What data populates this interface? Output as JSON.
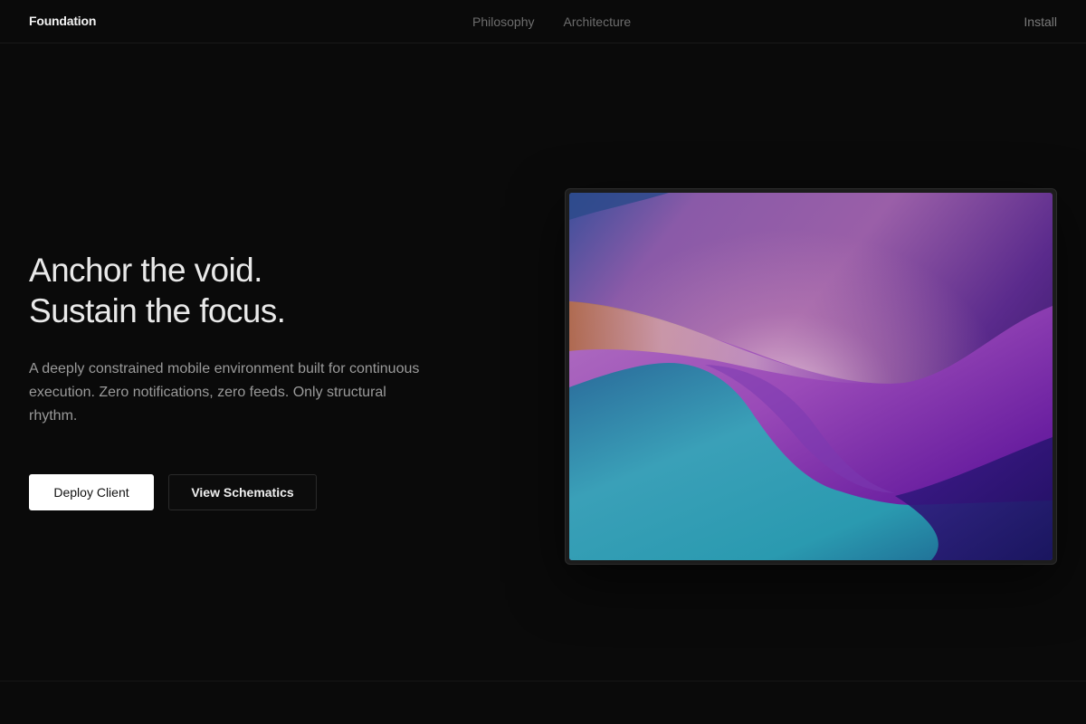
{
  "header": {
    "brand": "Foundation",
    "nav": [
      "Philosophy",
      "Architecture"
    ],
    "install": "Install"
  },
  "hero": {
    "headline_line1": "Anchor the void.",
    "headline_line2": "Sustain the focus.",
    "description": "A deeply constrained mobile environment built for continuous execution. Zero notifications, zero feeds. Only structural rhythm.",
    "primary_button": "Deploy Client",
    "secondary_button": "View Schematics"
  },
  "colors": {
    "background": "#0a0a0a",
    "primary_button_bg": "#ffffff",
    "wallpaper_teal": "#2aa0b8",
    "wallpaper_purple": "#6a1fa0",
    "wallpaper_orange": "#c47a3a"
  }
}
